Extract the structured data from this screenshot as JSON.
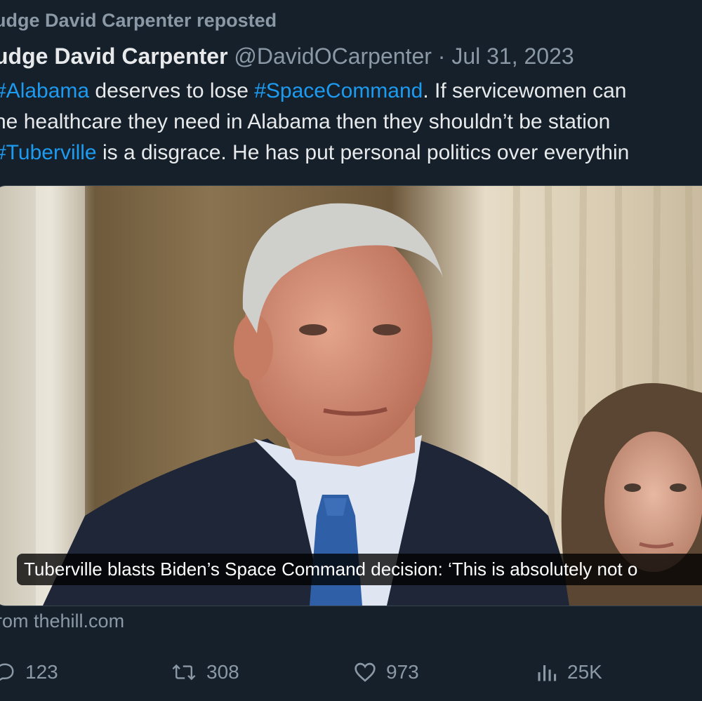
{
  "repost_notice": "udge David Carpenter reposted",
  "tweet": {
    "author_name": "udge David Carpenter",
    "handle": "@DavidOCarpenter",
    "separator": "·",
    "date": "Jul 31, 2023",
    "lines": [
      [
        {
          "text": "#Alabama",
          "hashtag": true
        },
        {
          "text": " deserves to lose ",
          "hashtag": false
        },
        {
          "text": "#SpaceCommand",
          "hashtag": true
        },
        {
          "text": ". If servicewomen can",
          "hashtag": false
        }
      ],
      [
        {
          "text": "he healthcare they need in Alabama then they shouldn’t be station",
          "hashtag": false
        }
      ],
      [
        {
          "text": "#Tuberville",
          "hashtag": true
        },
        {
          "text": " is a disgrace. He has put personal politics over everythin",
          "hashtag": false
        }
      ]
    ]
  },
  "card": {
    "caption": "Tuberville blasts Biden’s Space Command decision: ‘This is absolutely not o",
    "source": "rom thehill.com"
  },
  "actions": {
    "replies": "123",
    "reposts": "308",
    "likes": "973",
    "views": "25K"
  },
  "colors": {
    "background": "#15202b",
    "primary_text": "#e7e9ea",
    "secondary_text": "#8b98a5",
    "link": "#1d9bf0"
  }
}
